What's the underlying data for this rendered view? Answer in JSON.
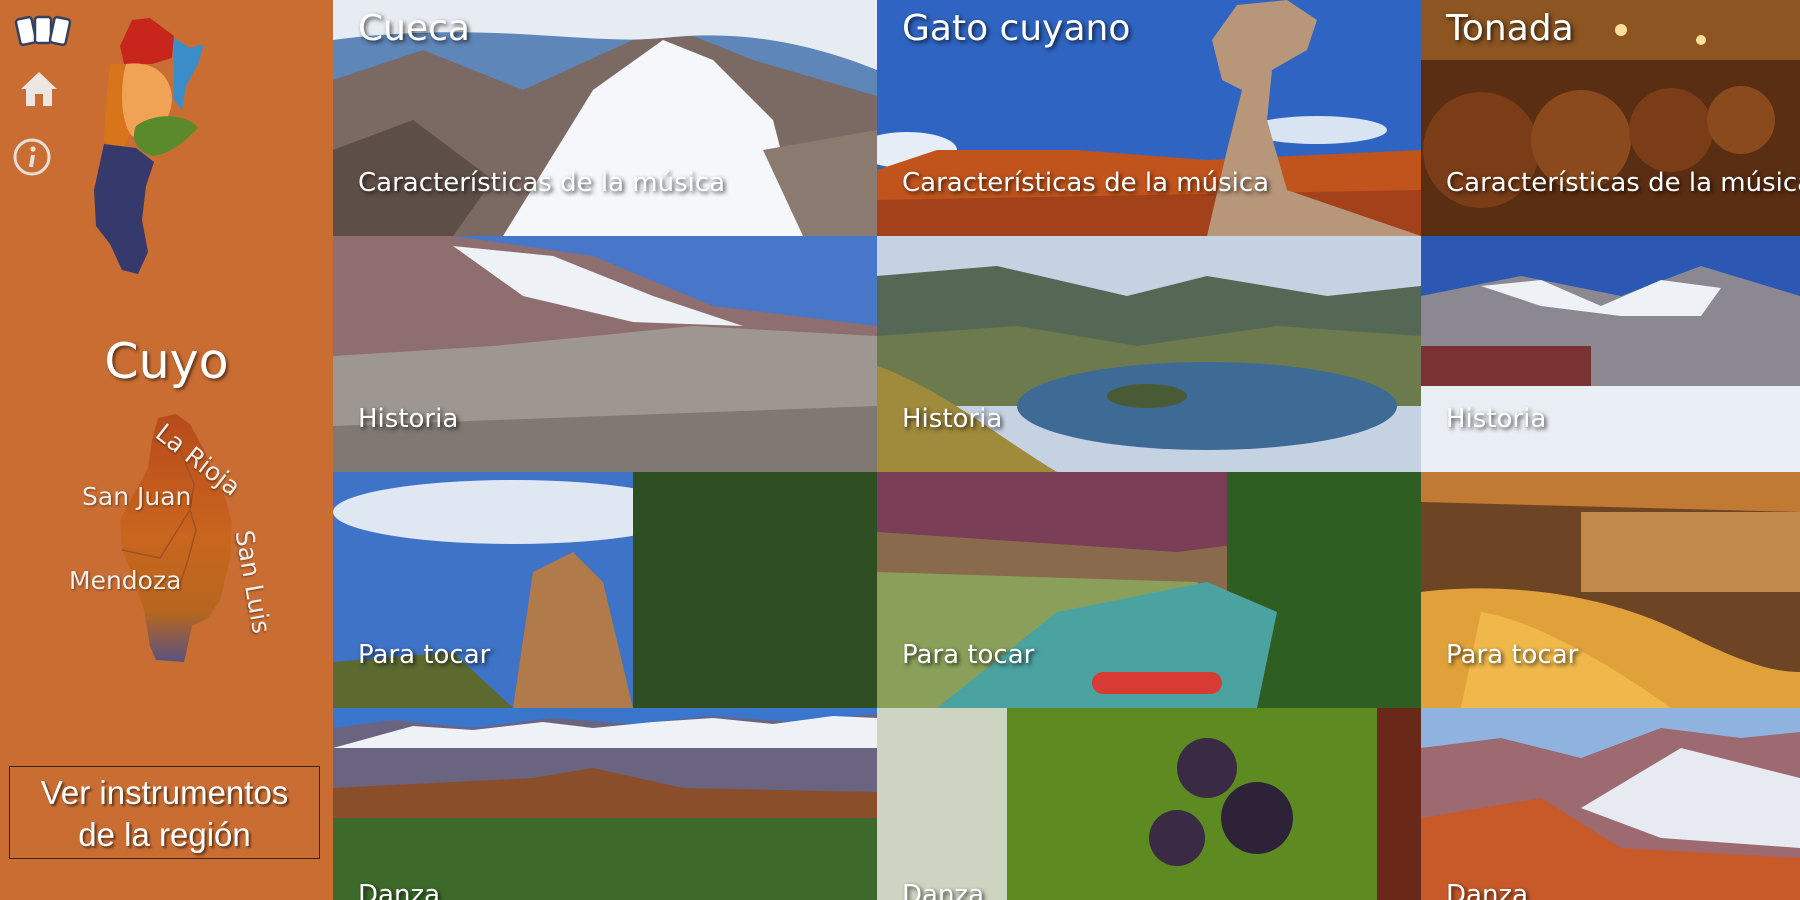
{
  "sidebar": {
    "icons": [
      "cards-icon",
      "home-icon",
      "info-icon"
    ],
    "region_title": "Cuyo",
    "provinces": {
      "la_rioja": "La Rioja",
      "san_juan": "San Juan",
      "san_luis": "San Luis",
      "mendoza": "Mendoza"
    },
    "instruments_button": {
      "line1": "Ver instrumentos",
      "line2": "de la región"
    }
  },
  "colors": {
    "sidebar_bg": "#c96d33",
    "map_red": "#c8261d",
    "map_orange_dark": "#d8751b",
    "map_orange_light": "#f1a355",
    "map_blue": "#3b8dc9",
    "map_green": "#5b8a2c",
    "map_navy": "#36396b"
  },
  "tiles": [
    {
      "row": 1,
      "col": 1,
      "title": "Cueca",
      "caption": "Características de la música"
    },
    {
      "row": 1,
      "col": 2,
      "title": "Gato cuyano",
      "caption": "Características de la música"
    },
    {
      "row": 1,
      "col": 3,
      "title": "Tonada",
      "caption": "Características de la música"
    },
    {
      "row": 2,
      "col": 1,
      "title": "",
      "caption": "Historia"
    },
    {
      "row": 2,
      "col": 2,
      "title": "",
      "caption": "Historia"
    },
    {
      "row": 2,
      "col": 3,
      "title": "",
      "caption": "Historia"
    },
    {
      "row": 3,
      "col": 1,
      "title": "",
      "caption": "Para tocar"
    },
    {
      "row": 3,
      "col": 2,
      "title": "",
      "caption": "Para tocar"
    },
    {
      "row": 3,
      "col": 3,
      "title": "",
      "caption": "Para tocar"
    },
    {
      "row": 4,
      "col": 1,
      "title": "",
      "caption": "Danza"
    },
    {
      "row": 4,
      "col": 2,
      "title": "",
      "caption": "Danza"
    },
    {
      "row": 4,
      "col": 3,
      "title": "",
      "caption": "Danza"
    }
  ]
}
